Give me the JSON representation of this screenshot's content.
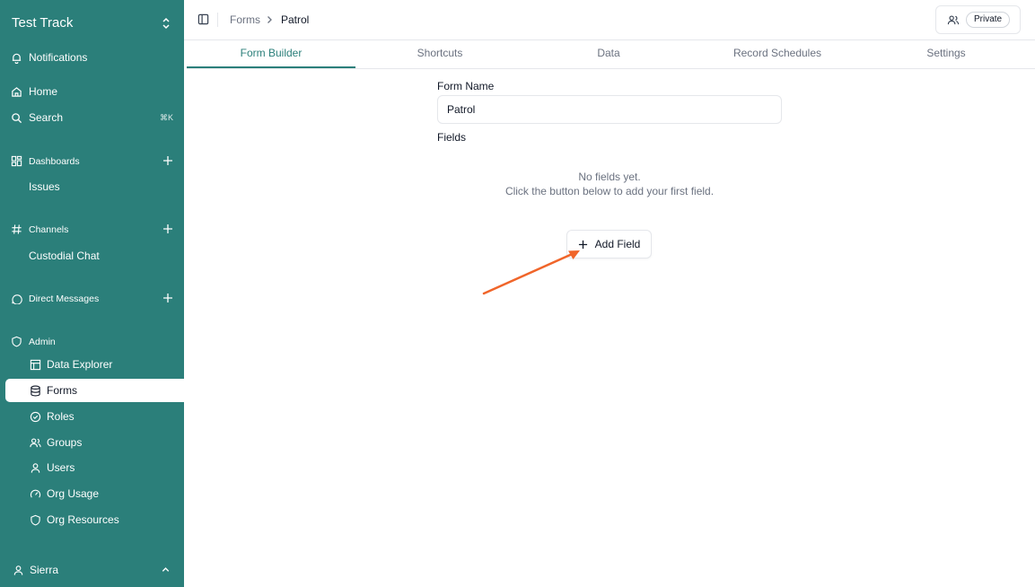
{
  "sidebar": {
    "workspace": "Test Track",
    "notifications": "Notifications",
    "home": "Home",
    "search": "Search",
    "search_shortcut": "⌘K",
    "dashboards": "Dashboards",
    "dashboard_items": [
      "Issues"
    ],
    "channels": "Channels",
    "channel_items": [
      "Custodial Chat"
    ],
    "direct_messages": "Direct Messages",
    "admin": "Admin",
    "admin_items": [
      "Data Explorer",
      "Forms",
      "Roles",
      "Groups",
      "Users",
      "Org Usage",
      "Org Resources"
    ],
    "user": "Sierra"
  },
  "header": {
    "breadcrumb": [
      "Forms",
      "Patrol"
    ],
    "visibility": "Private"
  },
  "tabs": [
    "Form Builder",
    "Shortcuts",
    "Data",
    "Record Schedules",
    "Settings"
  ],
  "active_tab": "Form Builder",
  "form": {
    "name_label": "Form Name",
    "name_value": "Patrol",
    "fields_label": "Fields",
    "empty_line1": "No fields yet.",
    "empty_line2": "Click the button below to add your first field.",
    "add_field": "Add Field"
  },
  "colors": {
    "sidebar": "#2b7f7a",
    "accent": "#2b7f7a",
    "arrow": "#f0652a"
  }
}
